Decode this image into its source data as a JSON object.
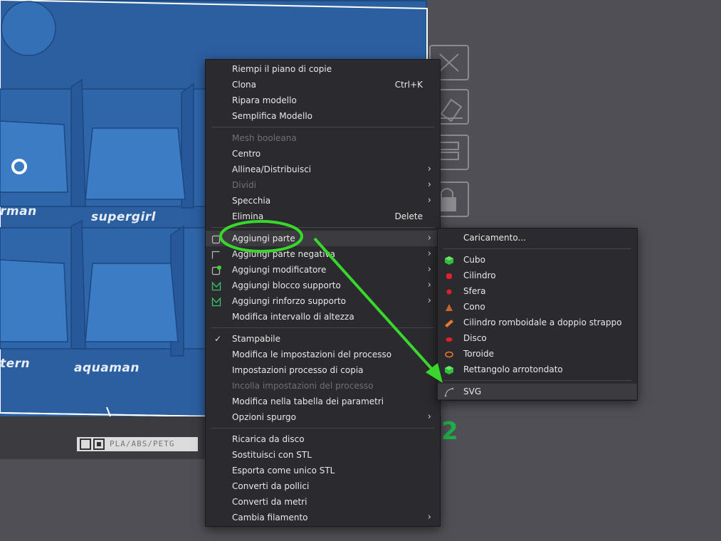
{
  "scene": {
    "hero_names": [
      "rman",
      "supergirl",
      "tern",
      "aquaman"
    ],
    "plate_label": "PLA/ABS/PETG",
    "plate_number": "2",
    "side_tools": [
      "close-icon",
      "auto-arrange-icon",
      "layout-icon",
      "lock-icon"
    ]
  },
  "context_menu": {
    "items": [
      {
        "label": "Riempi il piano di copie"
      },
      {
        "label": "Clona",
        "shortcut": "Ctrl+K"
      },
      {
        "label": "Ripara modello"
      },
      {
        "label": "Semplifica Modello"
      },
      {
        "label": "Mesh booleana",
        "disabled": true
      },
      {
        "label": "Centro"
      },
      {
        "label": "Allinea/Distribuisci",
        "submenu": true
      },
      {
        "label": "Dividi",
        "submenu": true,
        "disabled": true
      },
      {
        "label": "Specchia",
        "submenu": true
      },
      {
        "label": "Elimina",
        "shortcut": "Delete"
      },
      {
        "label": "Aggiungi parte",
        "submenu": true,
        "highlighted": true
      },
      {
        "label": "Aggiungi parte negativa",
        "submenu": true
      },
      {
        "label": "Aggiungi modificatore",
        "submenu": true
      },
      {
        "label": "Aggiungi blocco supporto",
        "submenu": true
      },
      {
        "label": "Aggiungi rinforzo supporto",
        "submenu": true
      },
      {
        "label": "Modifica intervallo di altezza"
      },
      {
        "label": "Stampabile",
        "checked": true
      },
      {
        "label": "Modifica le impostazioni del processo"
      },
      {
        "label": "Impostazioni processo di copia"
      },
      {
        "label": "Incolla impostazioni del processo",
        "disabled": true
      },
      {
        "label": "Modifica nella tabella dei parametri"
      },
      {
        "label": "Opzioni spurgo",
        "submenu": true
      },
      {
        "label": "Ricarica da disco"
      },
      {
        "label": "Sostituisci con STL"
      },
      {
        "label": "Esporta come unico STL"
      },
      {
        "label": "Converti da pollici"
      },
      {
        "label": "Converti da metri"
      },
      {
        "label": "Cambia filamento",
        "submenu": true
      }
    ]
  },
  "submenu": {
    "items": [
      {
        "label": "Caricamento..."
      },
      {
        "label": "Cubo",
        "icon": "cube-icon"
      },
      {
        "label": "Cilindro",
        "icon": "cylinder-icon"
      },
      {
        "label": "Sfera",
        "icon": "sphere-icon"
      },
      {
        "label": "Cono",
        "icon": "cone-icon"
      },
      {
        "label": "Cilindro romboidale a doppio strappo",
        "icon": "double-tear-cylinder-icon"
      },
      {
        "label": "Disco",
        "icon": "disc-icon"
      },
      {
        "label": "Toroide",
        "icon": "torus-icon"
      },
      {
        "label": "Rettangolo arrotondato",
        "icon": "rounded-rectangle-icon"
      },
      {
        "label": "SVG",
        "icon": "svg-icon",
        "highlighted": true
      }
    ]
  },
  "colors": {
    "menu_bg": "#2b2b2f",
    "highlight": "#3b3b40",
    "annotation_green": "#39d62b",
    "model_blue": "#2c5fa0"
  }
}
